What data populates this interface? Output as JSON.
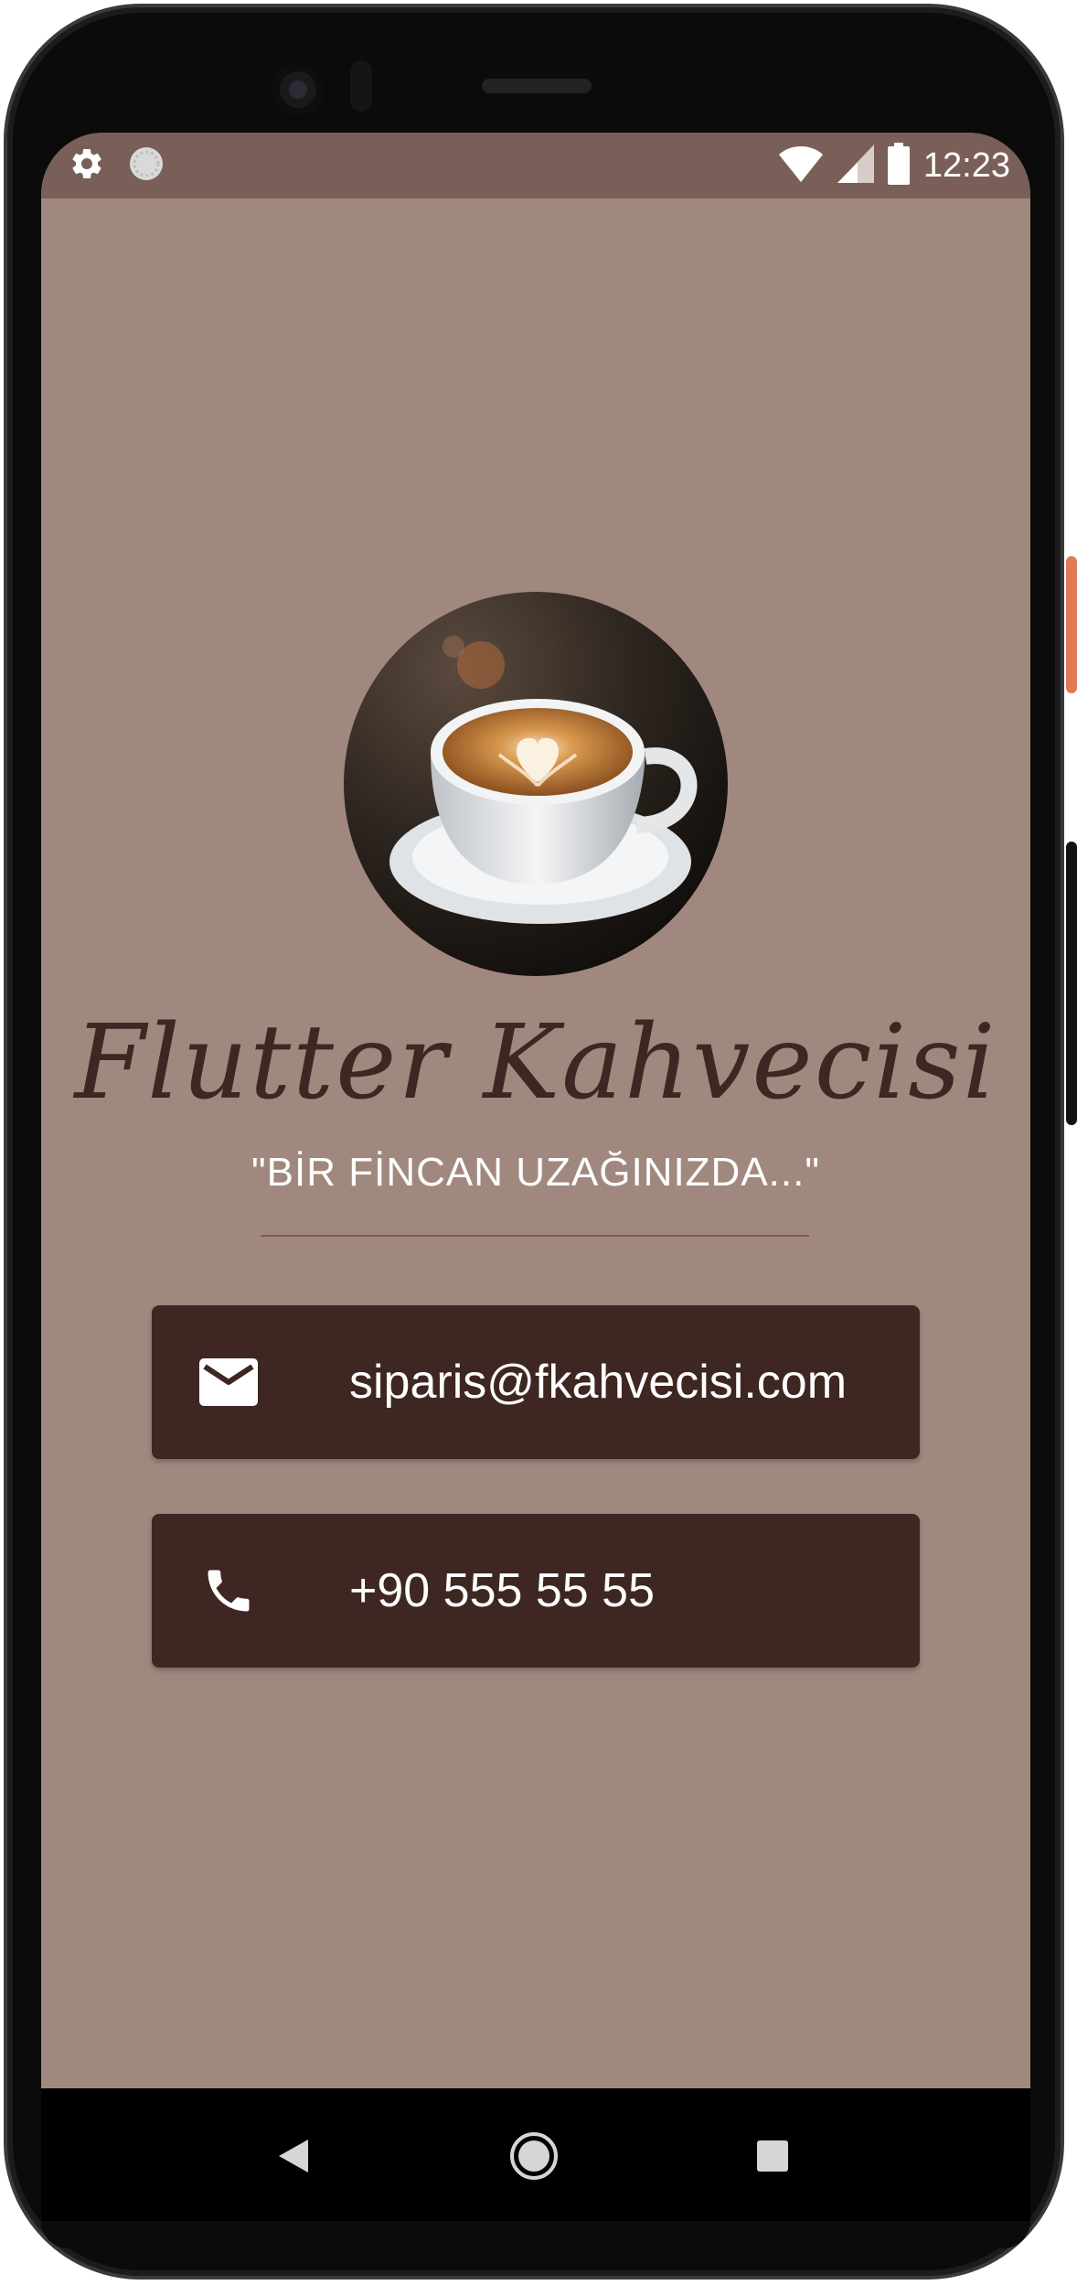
{
  "status_bar": {
    "time": "12:23",
    "left_icons": [
      "gear-icon",
      "sync-circle-icon"
    ],
    "right_icons": [
      "wifi-icon",
      "cellular-signal-icon",
      "battery-icon"
    ]
  },
  "app": {
    "title": "Flutter Kahvecisi",
    "tagline": "\"BİR FİNCAN UZAĞINIZDA...\"",
    "avatar_image": "coffee-cup-latte-art"
  },
  "contacts": [
    {
      "icon": "mail-icon",
      "text": "siparis@fkahvecisi.com"
    },
    {
      "icon": "phone-icon",
      "text": "+90 555 55 55"
    }
  ],
  "nav_bar": {
    "buttons": [
      "back-icon",
      "home-icon",
      "recents-icon"
    ]
  },
  "colors": {
    "background": "#a1887f",
    "status_bar": "#795f57",
    "card": "#3e2723",
    "title": "#3e2723",
    "text_on_card": "#ffffff",
    "divider": "#7b6058"
  }
}
